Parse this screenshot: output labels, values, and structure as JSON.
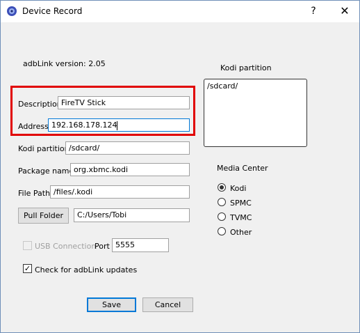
{
  "window": {
    "title": "Device Record",
    "help_glyph": "?",
    "close_glyph": "✕"
  },
  "version_label": "adbLink version: 2.05",
  "kodi_partition_panel": {
    "label": "Kodi partition",
    "value": "/sdcard/"
  },
  "fields": {
    "description": {
      "label": "Description",
      "value": "FireTV Stick"
    },
    "address": {
      "label": "Address",
      "value": "192.168.178.124"
    },
    "kodi_partition": {
      "label": "Kodi partition",
      "value": "/sdcard/"
    },
    "package_name": {
      "label": "Package name",
      "value": "org.xbmc.kodi"
    },
    "file_path": {
      "label": "File Path",
      "value": "/files/.kodi"
    }
  },
  "pull_folder": {
    "button_label": "Pull Folder",
    "value": "C:/Users/Tobi"
  },
  "usb_connection": {
    "label": "USB Connection",
    "checked": false,
    "disabled": true
  },
  "port": {
    "label": "Port",
    "value": "5555"
  },
  "check_updates": {
    "label": "Check for adbLink updates",
    "checked": true
  },
  "media_center": {
    "label": "Media Center",
    "options": [
      {
        "label": "Kodi",
        "selected": true
      },
      {
        "label": "SPMC",
        "selected": false
      },
      {
        "label": "TVMC",
        "selected": false
      },
      {
        "label": "Other",
        "selected": false
      }
    ]
  },
  "buttons": {
    "save_label": "Save",
    "cancel_label": "Cancel"
  },
  "colors": {
    "highlight_box": "#e10000",
    "focus_border": "#0078d7"
  },
  "icons": {
    "app": "disc-icon",
    "check": "✓"
  }
}
